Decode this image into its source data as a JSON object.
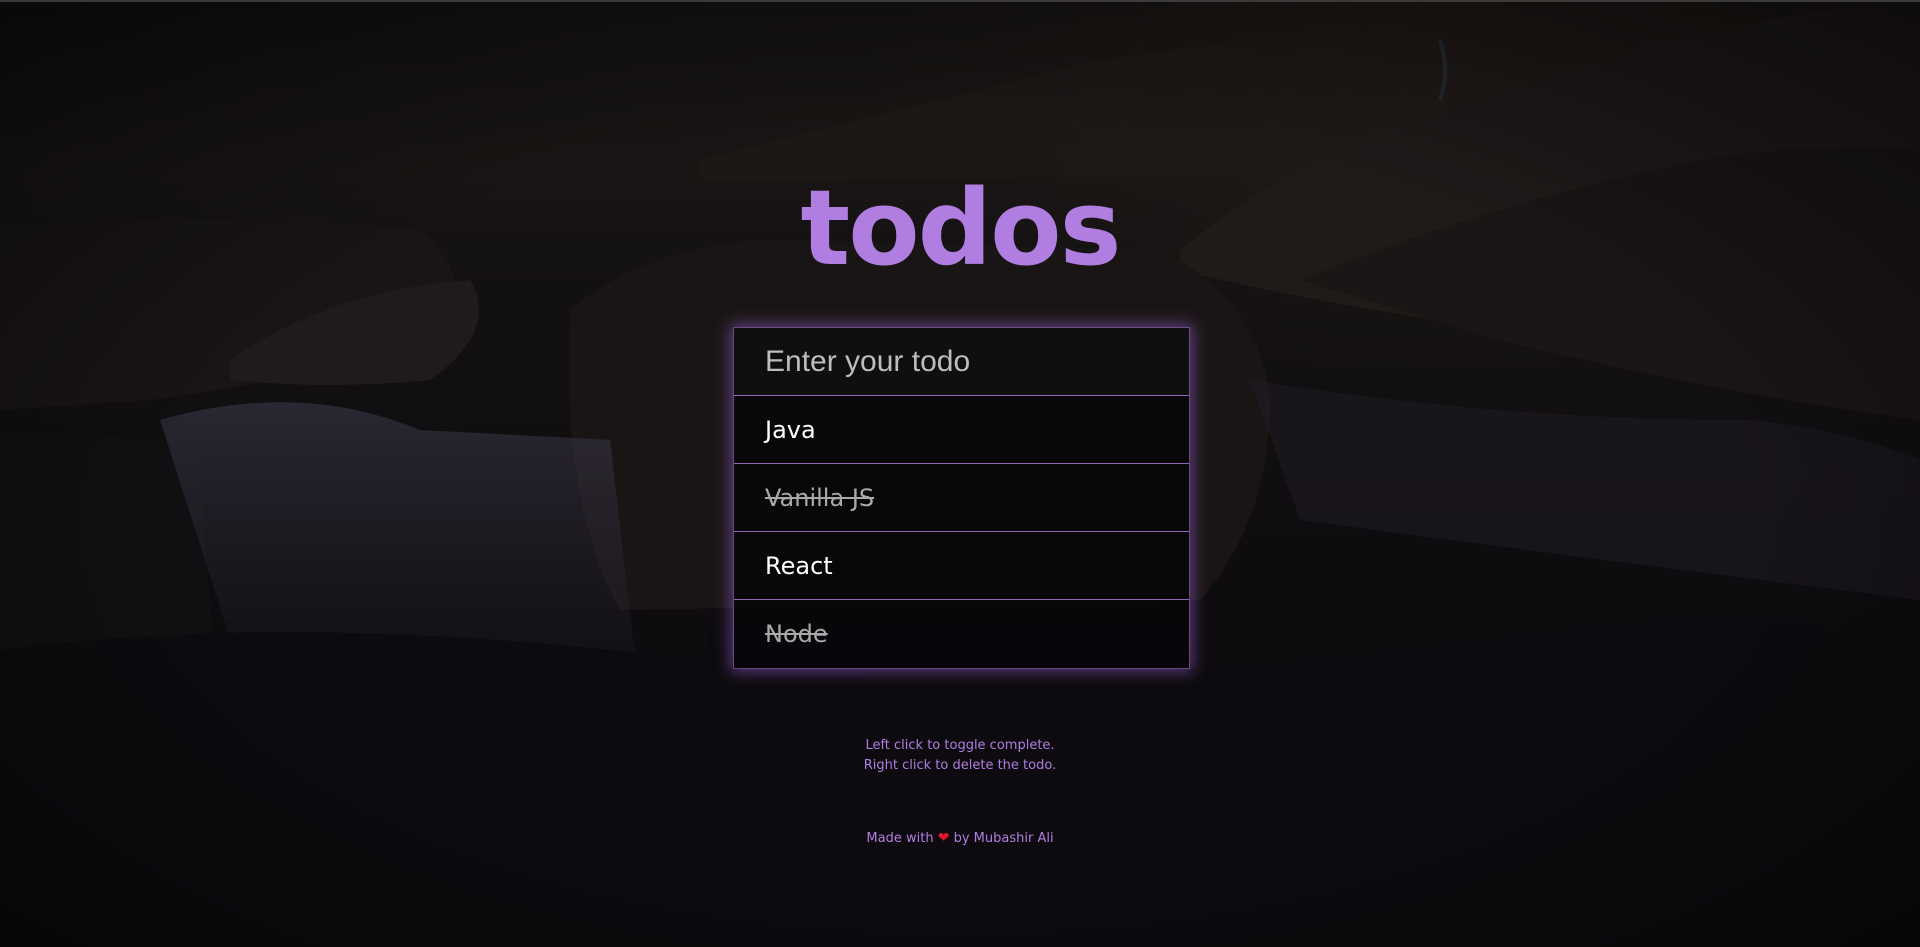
{
  "app": {
    "title": "todos"
  },
  "input": {
    "placeholder": "Enter your todo",
    "value": ""
  },
  "todos": [
    {
      "text": "Java",
      "completed": false
    },
    {
      "text": "Vanilla JS",
      "completed": true
    },
    {
      "text": "React",
      "completed": false
    },
    {
      "text": "Node",
      "completed": true
    }
  ],
  "hints": {
    "left_click": "Left click to toggle complete.",
    "right_click": "Right click to delete the todo."
  },
  "footer": {
    "prefix": "Made with",
    "heart_icon": "heart-icon",
    "suffix": "by Mubashir Ali"
  },
  "colors": {
    "accent": "#b07ee0",
    "heart": "#e0162b",
    "completed_text": "#a9a9a9",
    "text": "#ffffff"
  }
}
